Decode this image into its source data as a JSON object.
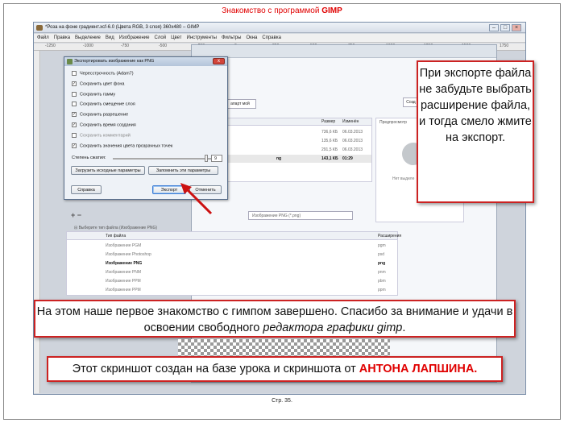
{
  "slide": {
    "title_prefix": "Знакомство с программой ",
    "title_app": "GIMP",
    "page_number": "Стр. 35."
  },
  "gimp": {
    "window_title": "*Роза на фоне градиент.xcf-6.0 (Цвета RGB, 3 слоя) 360x480 – GIMP",
    "menu": [
      "Файл",
      "Правка",
      "Выделение",
      "Вид",
      "Изображение",
      "Слой",
      "Цвет",
      "Инструменты",
      "Фильтры",
      "Окна",
      "Справка"
    ],
    "ruler_marks": [
      "-1250",
      "-1000",
      "-750",
      "-500",
      "-250",
      "0",
      "250",
      "500",
      "750",
      "1000",
      "1250",
      "1500",
      "1750"
    ]
  },
  "file_dialog": {
    "place_tab": "Роза",
    "folder_button": "апарт мой",
    "create_button": "Созд",
    "columns": {
      "size": "Размер",
      "modified": "Изменён"
    },
    "files": [
      {
        "name": "",
        "size": "736,6 КБ",
        "date": "06.03.2013",
        "selected": false
      },
      {
        "name": "",
        "size": "135,6 КБ",
        "date": "06.03.2013",
        "selected": false
      },
      {
        "name": "",
        "size": "291,5 КБ",
        "date": "06.03.2013",
        "selected": false
      },
      {
        "name": "ng",
        "size": "143,1 КБ",
        "date": "01:29",
        "selected": true
      }
    ],
    "preview_label": "Предпросмотр",
    "preview_empty": "Нет выделе",
    "filter_value": "Изображение PNG (*.png)",
    "type_expander": "⊟ Выберите тип файла (Изображение PNG)",
    "types_columns": {
      "type": "Тип файла",
      "ext": "Расширения"
    },
    "types": [
      {
        "type": "Изображение PGM",
        "ext": "pgm",
        "selected": false
      },
      {
        "type": "Изображение Photoshop",
        "ext": "psd",
        "selected": false
      },
      {
        "type": "Изображение PNG",
        "ext": "png",
        "selected": true
      },
      {
        "type": "Изображение PNM",
        "ext": "pnm",
        "selected": false
      },
      {
        "type": "Изображение PPM",
        "ext": "pbm",
        "selected": false
      },
      {
        "type": "Изображение PPM",
        "ext": "ppm",
        "selected": false
      }
    ]
  },
  "png_dialog": {
    "title": "Экспортировать изображение как PNG",
    "options": [
      {
        "label": "Чересстрочность (Adam7)",
        "checked": false,
        "enabled": true
      },
      {
        "label": "Сохранить цвет фона",
        "checked": true,
        "enabled": true
      },
      {
        "label": "Сохранить гамму",
        "checked": false,
        "enabled": true
      },
      {
        "label": "Сохранить смещение слоя",
        "checked": false,
        "enabled": true
      },
      {
        "label": "Сохранить разрешение",
        "checked": true,
        "enabled": true
      },
      {
        "label": "Сохранить время создания",
        "checked": true,
        "enabled": true
      },
      {
        "label": "Сохранить комментарий",
        "checked": false,
        "enabled": false
      },
      {
        "label": "Сохранить значения цвета прозрачных точек",
        "checked": true,
        "enabled": true
      }
    ],
    "compression_label": "Степень сжатия:",
    "compression_value": "9",
    "compression_max": 9,
    "load_defaults": "Загрузить исходные параметры",
    "save_defaults": "Запомнить эти параметры",
    "help": "Справка",
    "export": "Экспорт",
    "cancel": "Отменить"
  },
  "callouts": {
    "right": "При экспорте файла не забудьте выбрать расширение файла, и тогда смело жмите на экспорт.",
    "bottom1_text": "На этом наше первое знакомство с гимпом завершено. Спасибо за внимание и удачи в освоении свободного ",
    "bottom1_italic": "редактора графики gimp",
    "bottom1_end": ".",
    "bottom2_text": "Этот скриншот создан на базе урока и скриншота от ",
    "bottom2_author": "АНТОНА  ЛАПШИНА."
  },
  "colors": {
    "accent_red": "#e00000",
    "callout_border": "#cc2222"
  }
}
